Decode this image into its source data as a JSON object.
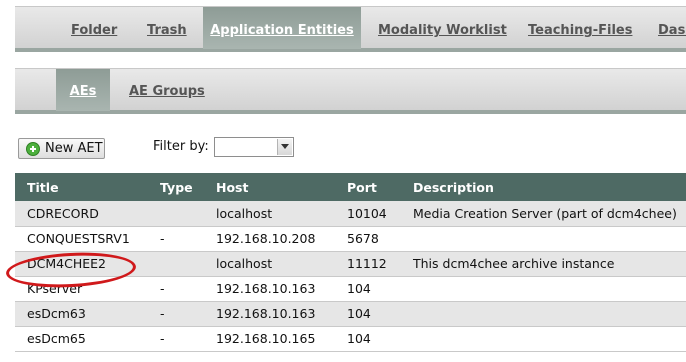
{
  "main_tabs": [
    {
      "label": "Folder",
      "active": false
    },
    {
      "label": "Trash",
      "active": false
    },
    {
      "label": "Application Entities",
      "active": true
    },
    {
      "label": "Modality Worklist",
      "active": false
    },
    {
      "label": "Teaching-Files",
      "active": false
    },
    {
      "label": "Dasl",
      "active": false
    }
  ],
  "sub_tabs": [
    {
      "label": "AEs",
      "active": true
    },
    {
      "label": "AE Groups",
      "active": false
    }
  ],
  "toolbar": {
    "new_aet_label": "New AET",
    "filter_label": "Filter by:",
    "filter_value": ""
  },
  "table": {
    "headers": [
      "Title",
      "Type",
      "Host",
      "Port",
      "Description"
    ],
    "rows": [
      {
        "title": "CDRECORD",
        "type": "",
        "host": "localhost",
        "port": "10104",
        "description": "Media Creation Server (part of dcm4chee)"
      },
      {
        "title": "CONQUESTSRV1",
        "type": "-",
        "host": "192.168.10.208",
        "port": "5678",
        "description": ""
      },
      {
        "title": "DCM4CHEE2",
        "type": "",
        "host": "localhost",
        "port": "11112",
        "description": "This dcm4chee archive instance"
      },
      {
        "title": "KPserver",
        "type": "-",
        "host": "192.168.10.163",
        "port": "104",
        "description": ""
      },
      {
        "title": "esDcm63",
        "type": "-",
        "host": "192.168.10.163",
        "port": "104",
        "description": ""
      },
      {
        "title": "esDcm65",
        "type": "-",
        "host": "192.168.10.165",
        "port": "104",
        "description": ""
      }
    ]
  },
  "colors": {
    "header_bg": "#4e6a64",
    "active_tab_bg": "#9aa6a1",
    "highlight": "#d0191b"
  }
}
